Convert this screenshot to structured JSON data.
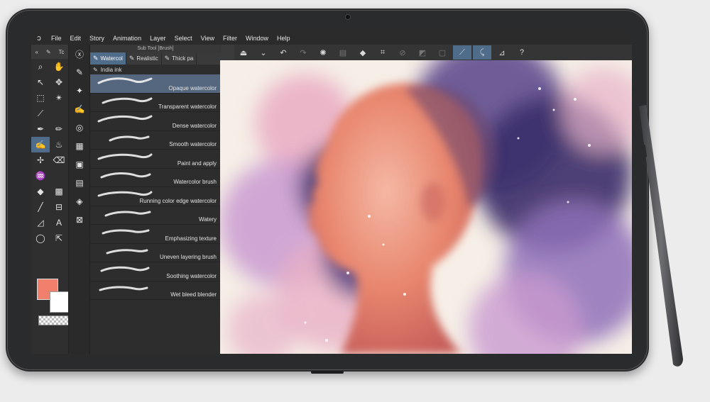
{
  "menu": {
    "items": [
      "File",
      "Edit",
      "Story",
      "Animation",
      "Layer",
      "Select",
      "View",
      "Filter",
      "Window",
      "Help"
    ]
  },
  "tool_column": {
    "header_left": "«",
    "header_right": "Tc"
  },
  "colors": {
    "main": "#f0806c",
    "sub": "#ffffff",
    "accent": "#4f6c8a",
    "app_bg": "#3b3b3b"
  },
  "brush_panel": {
    "title": "Sub Tool [Brush]",
    "tabs": [
      {
        "label": "Watercol",
        "active": true
      },
      {
        "label": "Realistic",
        "active": false
      },
      {
        "label": "Thick pa",
        "active": false
      }
    ],
    "group": "India ink",
    "brushes": [
      "Opaque watercolor",
      "Transparent watercolor",
      "Dense watercolor",
      "Smooth watercolor",
      "Paint and apply",
      "Watercolor brush",
      "Running color edge watercolor",
      "Watery",
      "Emphasizing texture",
      "Uneven layering brush",
      "Soothing watercolor",
      "Wet bleed blender"
    ],
    "selected_index": 0
  }
}
